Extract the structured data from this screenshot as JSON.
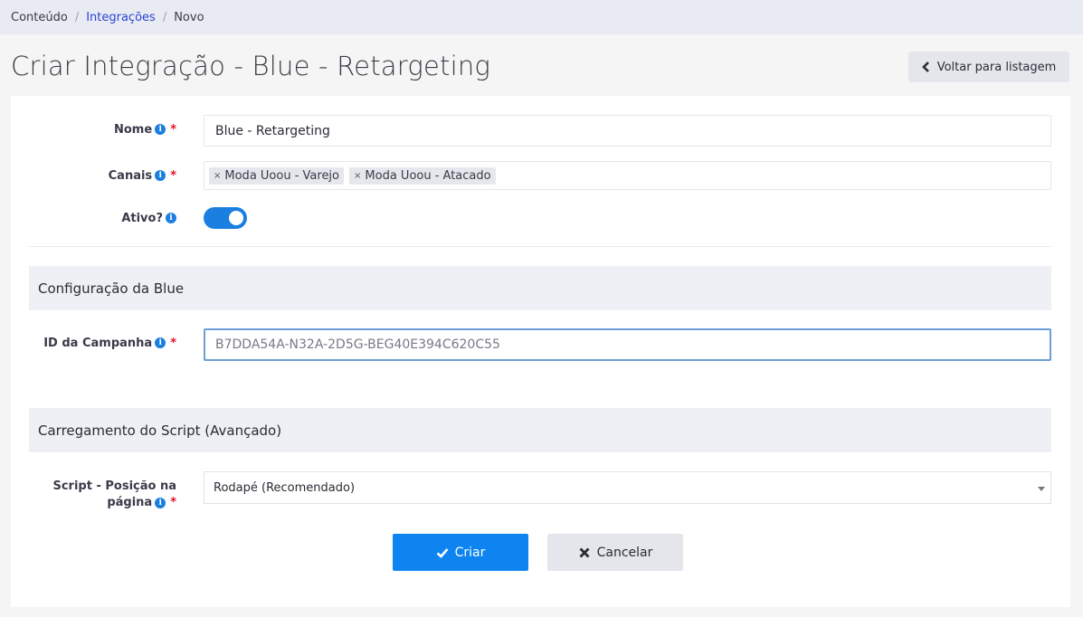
{
  "breadcrumb": {
    "items": [
      "Conteúdo",
      "Integrações",
      "Novo"
    ],
    "separator": "/"
  },
  "page": {
    "title": "Criar Integração - Blue - Retargeting",
    "back_label": "Voltar para listagem"
  },
  "form": {
    "nome": {
      "label": "Nome",
      "value": "Blue - Retargeting",
      "required_mark": "*"
    },
    "canais": {
      "label": "Canais",
      "tags": [
        "Moda Uoou - Varejo",
        "Moda Uoou - Atacado"
      ],
      "required_mark": "*",
      "remove_glyph": "×"
    },
    "ativo": {
      "label": "Ativo?",
      "on": true
    },
    "section_blue": "Configuração da Blue",
    "campanha": {
      "label": "ID da Campanha",
      "placeholder": "B7DDA54A-N32A-2D5G-BEG40E394C620C55",
      "required_mark": "*"
    },
    "section_script": "Carregamento do Script (Avançado)",
    "script_pos": {
      "label_line1": "Script - Posição na",
      "label_line2": "página",
      "value": "Rodapé (Recomendado)",
      "required_mark": "*"
    }
  },
  "actions": {
    "create_label": "Criar",
    "cancel_label": "Cancelar"
  },
  "icons": {
    "info": "info-icon",
    "back": "chevron-left-icon",
    "create": "check-icon",
    "cancel": "close-icon"
  },
  "colors": {
    "primary": "#0d84ef",
    "link": "#2a43d4",
    "required": "#e0132f",
    "info": "#1a7fe0"
  }
}
